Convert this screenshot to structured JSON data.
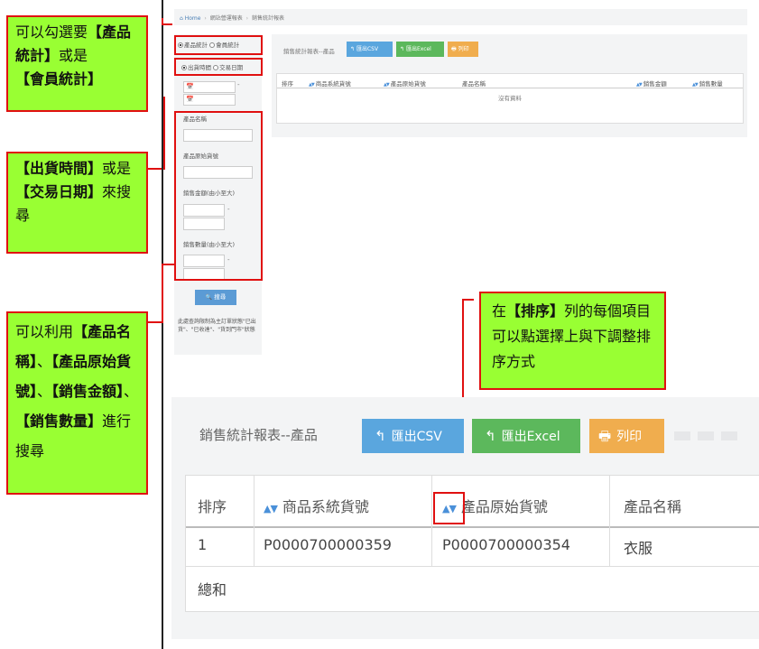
{
  "notes": {
    "n1": {
      "p1": "可以勾選要",
      "b1": "【產品統計】",
      "p2": "或是",
      "b2": "【會員統計】"
    },
    "n2": {
      "b1": "【出貨時間】",
      "p1": "或是",
      "b2": "【交易日期】",
      "p2": "來搜尋"
    },
    "n3": {
      "p1": "可以利用",
      "b1": "【產品名稱】",
      "p2": "、",
      "b2": "【產品原始貨號】",
      "p3": "、",
      "b3": "【銷售金額】",
      "p4": "、",
      "b4": "【銷售數量】",
      "p5": "進行搜尋"
    },
    "n4": {
      "p1": "在",
      "b1": "【排序】",
      "p2": "列的每個項目可以點選擇上與下調整排序方式"
    }
  },
  "breadcrumb": {
    "home": "Home",
    "level2": "網站營運報表",
    "level3": "銷售統計報表"
  },
  "sidebar": {
    "radio_product": "產品統計",
    "radio_member": "會員統計",
    "radio_ship_time": "出貨時間",
    "radio_trade_date": "交易日期",
    "calendar_icon": "📅",
    "range_dash": "-",
    "label_product_name": "產品名稱",
    "label_original_no": "產品原始貨號",
    "label_sales_amount": "銷售金額(由小至大)",
    "label_sales_qty": "銷售數量(由小至大)",
    "search_button": "搜尋",
    "note": "此處查詢限制為主訂單狀態\"已出貨\"、\"已收達\"、\"貨到門市\"狀態"
  },
  "mini_panel": {
    "title": "銷售統計報表--產品",
    "btn_csv": "匯出CSV",
    "btn_excel": "匯出Excel",
    "btn_print": "列印",
    "headers": [
      "排序",
      "商品系統貨號",
      "產品原始貨號",
      "產品名稱",
      "銷售金額",
      "銷售數量"
    ],
    "empty_text": "沒有資料"
  },
  "big_panel": {
    "title": "銷售統計報表--產品",
    "btn_csv": "匯出CSV",
    "btn_excel": "匯出Excel",
    "btn_print": "列印",
    "headers": [
      "排序",
      "商品系統貨號",
      "產品原始貨號",
      "產品名稱"
    ],
    "rows": [
      [
        "1",
        "P0000700000359",
        "P0000700000354",
        "衣服"
      ],
      [
        "總和",
        "",
        "",
        ""
      ]
    ]
  },
  "icons": {
    "sort": "▲▼",
    "reply": "↰",
    "print": "🖶",
    "home": "⌂",
    "search": "🔍"
  },
  "colors": {
    "note_bg": "#99ff33",
    "note_border": "#e01010",
    "btn_csv": "#5aa6de",
    "btn_excel": "#5cb85c",
    "btn_print": "#f0ad4e"
  }
}
